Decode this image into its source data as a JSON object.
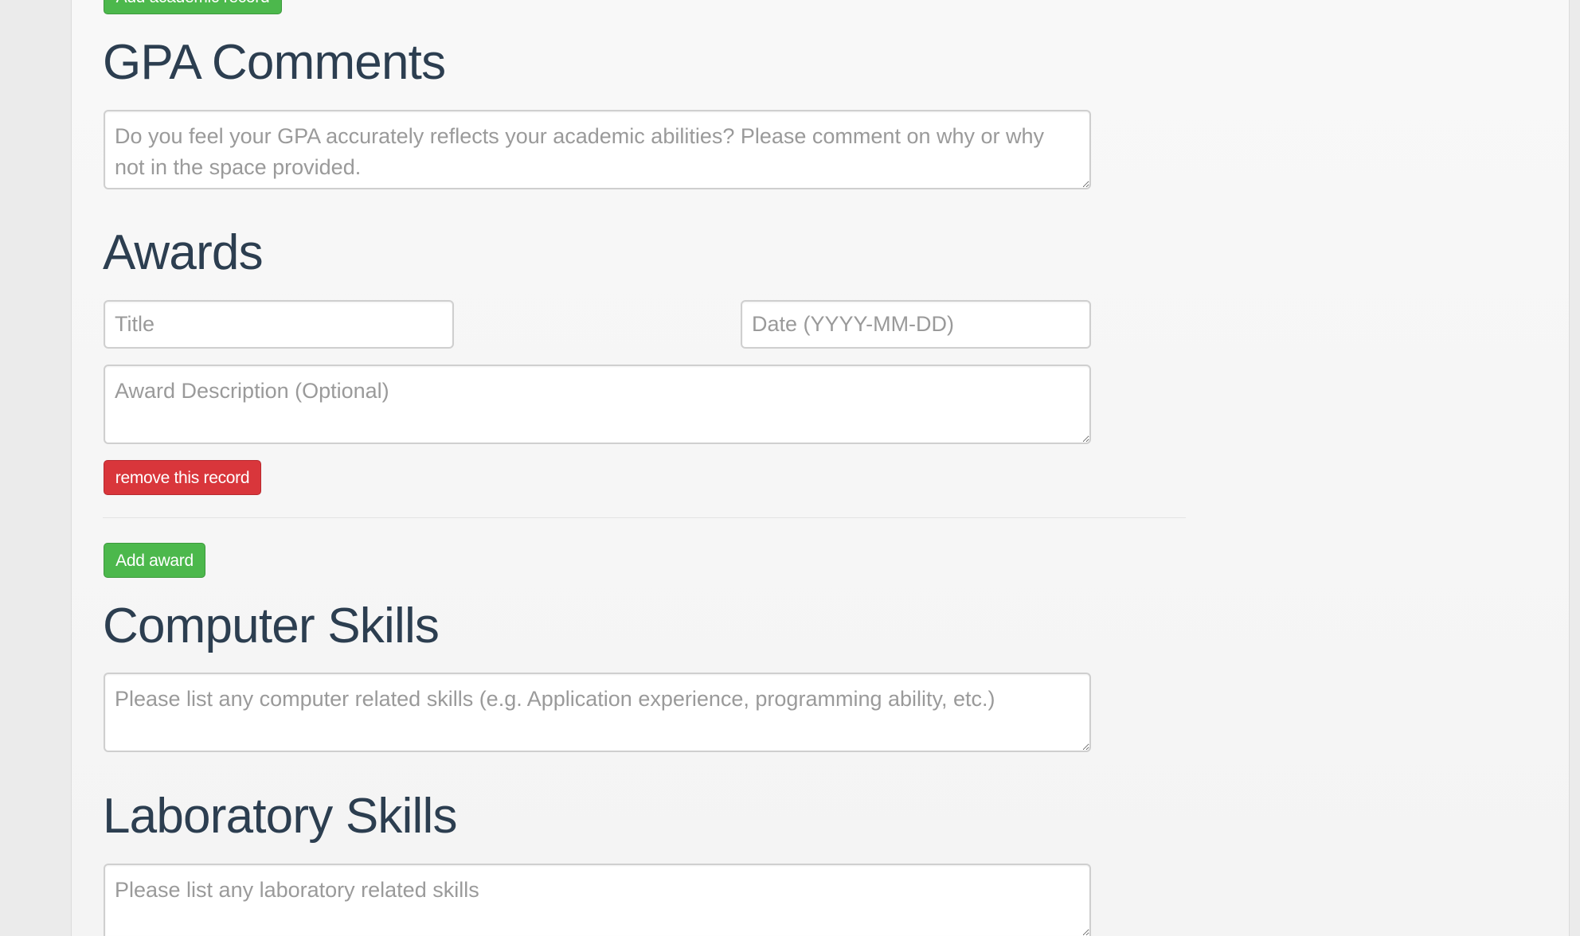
{
  "academic": {
    "add_button_label": "Add academic record"
  },
  "gpa": {
    "heading": "GPA Comments",
    "textarea_placeholder": "Do you feel your GPA accurately reflects your academic abilities? Please comment on why or why not in the space provided."
  },
  "awards": {
    "heading": "Awards",
    "title_placeholder": "Title",
    "date_placeholder": "Date (YYYY-MM-DD)",
    "description_placeholder": "Award Description (Optional)",
    "remove_button_label": "remove this record",
    "add_button_label": "Add award"
  },
  "computer_skills": {
    "heading": "Computer Skills",
    "textarea_placeholder": "Please list any computer related skills (e.g. Application experience, programming ability, etc.)"
  },
  "lab_skills": {
    "heading": "Laboratory Skills",
    "textarea_placeholder": "Please list any laboratory related skills"
  },
  "colors": {
    "success_button": "#4cb84c",
    "danger_button": "#d9363b",
    "heading_text": "#2c3e50",
    "placeholder_text": "#9a9a9a"
  }
}
